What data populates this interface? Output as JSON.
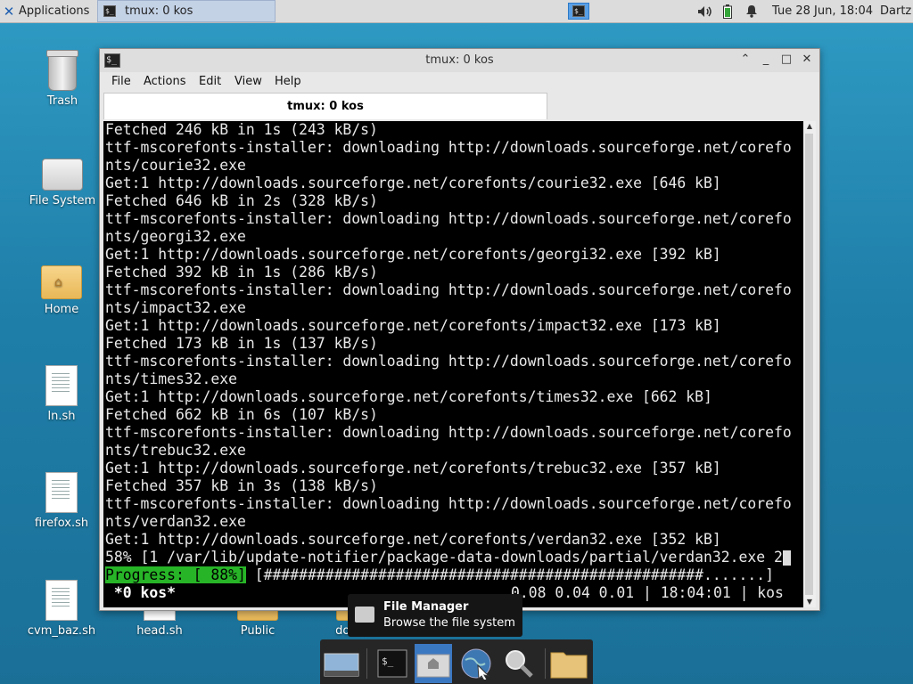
{
  "top_panel": {
    "applications_label": "Applications",
    "task_label": "tmux: 0 kos",
    "clock": "Tue 28 Jun, 18:04",
    "user": "Dartz",
    "icons": [
      "terminal-icon",
      "volume-icon",
      "battery-icon",
      "notification-bell-icon"
    ]
  },
  "desktop": {
    "icons": [
      {
        "label": "Trash",
        "icon": "trash-icon"
      },
      {
        "label": "File System",
        "icon": "hard-drive-icon"
      },
      {
        "label": "Home",
        "icon": "home-folder-icon"
      },
      {
        "label": "ln.sh",
        "icon": "script-file-icon"
      },
      {
        "label": "firefox.sh",
        "icon": "script-file-icon"
      },
      {
        "label": "cvm_baz.sh",
        "icon": "script-file-icon"
      },
      {
        "label": "head.sh",
        "icon": "script-file-icon"
      },
      {
        "label": "Public",
        "icon": "folder-icon"
      },
      {
        "label": "dotfiles",
        "icon": "folder-icon"
      }
    ]
  },
  "window": {
    "title": "tmux: 0 kos",
    "menu": [
      "File",
      "Actions",
      "Edit",
      "View",
      "Help"
    ],
    "tab_label": "tmux: 0 kos",
    "terminal_lines": [
      "Fetched 246 kB in 1s (243 kB/s)",
      "ttf-mscorefonts-installer: downloading http://downloads.sourceforge.net/corefo",
      "nts/courie32.exe",
      "Get:1 http://downloads.sourceforge.net/corefonts/courie32.exe [646 kB]",
      "Fetched 646 kB in 2s (328 kB/s)",
      "ttf-mscorefonts-installer: downloading http://downloads.sourceforge.net/corefo",
      "nts/georgi32.exe",
      "Get:1 http://downloads.sourceforge.net/corefonts/georgi32.exe [392 kB]",
      "Fetched 392 kB in 1s (286 kB/s)",
      "ttf-mscorefonts-installer: downloading http://downloads.sourceforge.net/corefo",
      "nts/impact32.exe",
      "Get:1 http://downloads.sourceforge.net/corefonts/impact32.exe [173 kB]",
      "Fetched 173 kB in 1s (137 kB/s)",
      "ttf-mscorefonts-installer: downloading http://downloads.sourceforge.net/corefo",
      "nts/times32.exe",
      "Get:1 http://downloads.sourceforge.net/corefonts/times32.exe [662 kB]",
      "Fetched 662 kB in 6s (107 kB/s)",
      "ttf-mscorefonts-installer: downloading http://downloads.sourceforge.net/corefo",
      "nts/trebuc32.exe",
      "Get:1 http://downloads.sourceforge.net/corefonts/trebuc32.exe [357 kB]",
      "Fetched 357 kB in 3s (138 kB/s)",
      "ttf-mscorefonts-installer: downloading http://downloads.sourceforge.net/corefo",
      "nts/verdan32.exe",
      "Get:1 http://downloads.sourceforge.net/corefonts/verdan32.exe [352 kB]",
      "58% [1 /var/lib/update-notifier/package-data-downloads/partial/verdan32.exe 2"
    ],
    "progress_label": "Progress: [ 88%]",
    "progress_bar": " [##################################################.......]",
    "progress_fraction": 0.88,
    "status_session": " *0 kos*",
    "status_right": "0.08 0.04 0.01 | 18:04:01 | kos"
  },
  "tooltip": {
    "title": "File Manager",
    "subtitle": "Browse the file system"
  },
  "dock": {
    "items": [
      "show-desktop-icon",
      "terminal-icon",
      "home-folder-icon",
      "web-browser-icon",
      "search-icon",
      "folder-icon"
    ]
  },
  "colors": {
    "desktop_bg": "#2484b3",
    "terminal_bg": "#000000",
    "progress_green": "#27b527",
    "panel_bg": "#dcdcdc"
  }
}
